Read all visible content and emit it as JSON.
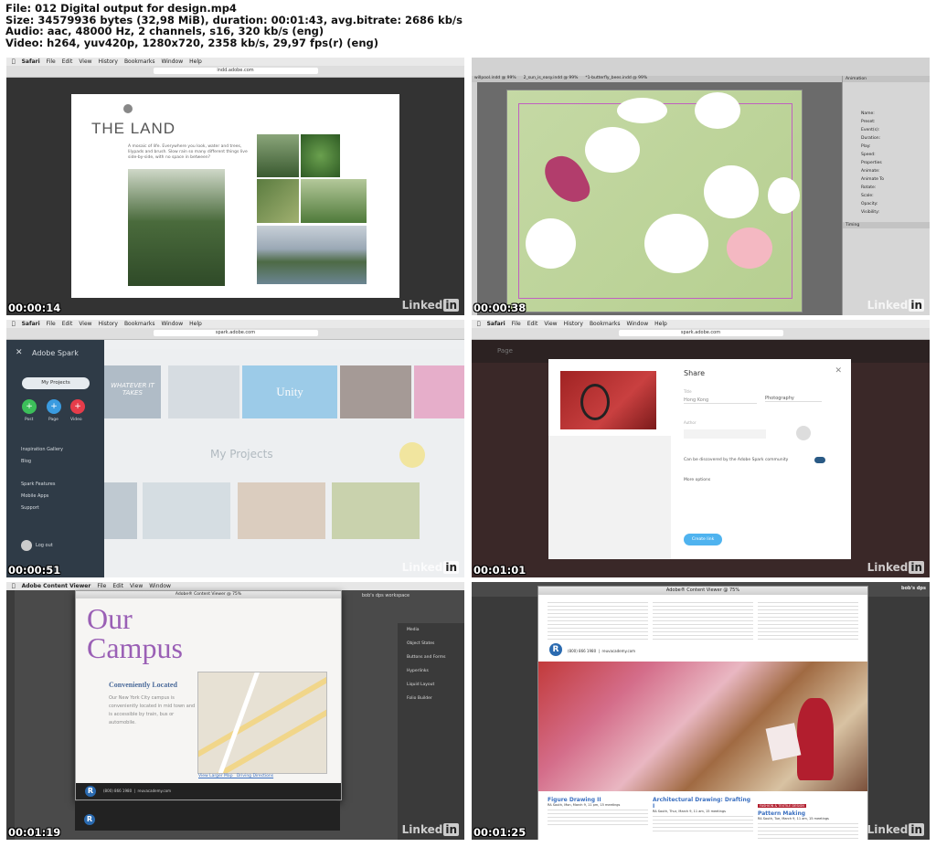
{
  "header": {
    "line1": "File: 012 Digital output for design.mp4",
    "line2": "Size: 34579936 bytes (32,98 MiB), duration: 00:01:43, avg.bitrate: 2686 kb/s",
    "line3": "Audio: aac, 48000 Hz, 2 channels, s16, 320 kb/s (eng)",
    "line4": "Video: h264, yuv420p, 1280x720, 2358 kb/s, 29,97 fps(r) (eng)"
  },
  "watermark": {
    "brand": "Linked",
    "suffix": "in"
  },
  "frames": [
    {
      "timestamp": "00:00:14",
      "menu": [
        "Safari",
        "File",
        "Edit",
        "View",
        "History",
        "Bookmarks",
        "Window",
        "Help"
      ],
      "url": "indd.adobe.com",
      "title": "THE LAND",
      "body": "A mosaic of life. Everywhere you look, water and trees, lilypads and brush. Slow rain so many different things live side-by-side, with no space in between?"
    },
    {
      "timestamp": "00:00:38",
      "tabs": [
        "willpool.indd @ 99%",
        "2_sun_is_easy.indd @ 99%",
        "*1-butterfly_bees.indd @ 99%"
      ],
      "panel_title": "Animation",
      "panel_fields": [
        "Name:",
        "Preset:",
        "Event(s):",
        "Duration:",
        "Play:",
        "Speed:",
        "Properties",
        "Animate:",
        "Animate To",
        "Rotate:",
        "Scale:",
        "Opacity:",
        "Visibility:"
      ],
      "panel_footer": "Timing"
    },
    {
      "timestamp": "00:00:51",
      "url": "spark.adobe.com",
      "brand": "Adobe Spark",
      "my_projects_btn": "My Projects",
      "create": [
        "Post",
        "Page",
        "Video"
      ],
      "links": [
        "Inspiration Gallery",
        "Blog",
        "Spark Features",
        "Mobile Apps",
        "Support"
      ],
      "logout": "Log out",
      "heading": "My Projects",
      "card1": "WHATEVER IT TAKES",
      "card2": "Unity"
    },
    {
      "timestamp": "00:01:01",
      "url": "spark.adobe.com",
      "app": "Page",
      "dialog_title": "Share",
      "title_label": "Title",
      "title_value": "Hong Kong",
      "category": "Photography",
      "author_label": "Author",
      "discover": "Can be discovered by the Adobe Spark community",
      "more": "More options",
      "button": "Create link"
    },
    {
      "timestamp": "00:01:19",
      "app": "Adobe Content Viewer",
      "menu": [
        "File",
        "Edit",
        "View",
        "Window"
      ],
      "window_title": "Adobe® Content Viewer @ 75%",
      "workspace": "bob's dps workspace",
      "heading": "Our Campus",
      "sub": "Conveniently Located",
      "body": "Our New York City campus is conveniently located in mid town and is accessible by train, bus or automobile.",
      "links": "View Larger Map   Driving Directions",
      "phone": "(800) 866 1980  |  reuvacademy.com",
      "panel": [
        "Media",
        "Object States",
        "Buttons and Forms",
        "Hyperlinks",
        "Liquid Layout",
        "Folio Builder"
      ]
    },
    {
      "timestamp": "00:01:25",
      "window_title": "Adobe® Content Viewer @ 75%",
      "workspace": "bob's dps",
      "phone": "(800) 866 1980  |  reuvacademy.com",
      "courses": [
        {
          "title": "Figure Drawing II",
          "meta": "RA South, Mon, March 9, 11 pm, 15 meetings"
        },
        {
          "title": "Architectural Drawing: Drafting I",
          "meta": "RA South, Thur, March 9, 11 am, 15 meetings"
        },
        {
          "title": "Pattern Making",
          "meta": "RA South, Tue, March 9, 11 am, 15 meetings"
        }
      ],
      "tag": "FASHION & TEXTILE DESIGN"
    }
  ],
  "colors": {
    "campus_purple": "#9a5fb5",
    "spark_blue": "#3a8fe0",
    "share_btn": "#4fb3ef"
  }
}
